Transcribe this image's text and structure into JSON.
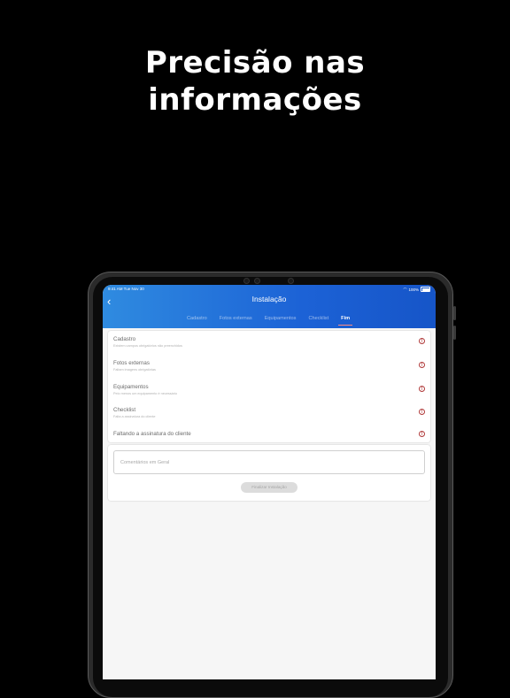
{
  "headline": {
    "line1": "Precisão nas",
    "line2": "informações"
  },
  "status_bar": {
    "time_date": "9:41 AM  Tue Nov 30",
    "battery": "100%"
  },
  "app": {
    "title": "Instalação",
    "tabs": [
      {
        "label": "Cadastro",
        "active": false
      },
      {
        "label": "Fotos externas",
        "active": false
      },
      {
        "label": "Equipamentos",
        "active": false
      },
      {
        "label": "Checklist",
        "active": false
      },
      {
        "label": "Fim",
        "active": true
      }
    ]
  },
  "summary": {
    "items": [
      {
        "title": "Cadastro",
        "subtitle": "Existem campos obrigatórios não preenchidos"
      },
      {
        "title": "Fotos externas",
        "subtitle": "Faltam imagens obrigatórias"
      },
      {
        "title": "Equipamentos",
        "subtitle": "Pelo menos um equipamento é necessário"
      },
      {
        "title": "Checklist",
        "subtitle": "Falta a assinatura do cliente"
      },
      {
        "title": "Faltando a assinatura do cliente",
        "subtitle": ""
      }
    ]
  },
  "comments": {
    "placeholder": "Comentários em Geral"
  },
  "finish_button": {
    "label": "Finalizar Instalação"
  },
  "colors": {
    "header_start": "#2f8be0",
    "header_end": "#1655c8",
    "alert": "#b03a3a",
    "tab_indicator": "#ff8a80"
  }
}
